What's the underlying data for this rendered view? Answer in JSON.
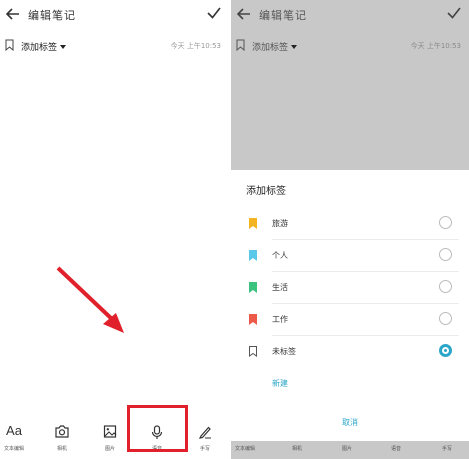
{
  "header": {
    "title": "编辑笔记",
    "back_icon": "back-arrow-icon",
    "confirm_icon": "checkmark-icon"
  },
  "note": {
    "tag_label": "添加标签",
    "timestamp": "今天 上午10:53"
  },
  "toolbar": {
    "items": [
      {
        "icon_text": "Aa",
        "label": "文本编辑",
        "icon": "text-format-icon"
      },
      {
        "label": "相机",
        "icon": "camera-icon"
      },
      {
        "label": "图片",
        "icon": "image-icon"
      },
      {
        "label": "语音",
        "icon": "microphone-icon"
      },
      {
        "label": "手写",
        "icon": "pen-icon"
      }
    ]
  },
  "tag_sheet": {
    "title": "添加标签",
    "options": [
      {
        "label": "旅游",
        "color": "#f4b320",
        "selected": false
      },
      {
        "label": "个人",
        "color": "#5ac8e8",
        "selected": false
      },
      {
        "label": "生活",
        "color": "#3bc27e",
        "selected": false
      },
      {
        "label": "工作",
        "color": "#ee5a4a",
        "selected": false
      },
      {
        "label": "未标签",
        "color": "outline",
        "selected": true
      }
    ],
    "new_label": "新建",
    "cancel_label": "取消"
  },
  "annotations": {
    "highlight_color": "#e0202a",
    "arrow_color": "#e0202a",
    "accent": "#2ba6c8"
  }
}
